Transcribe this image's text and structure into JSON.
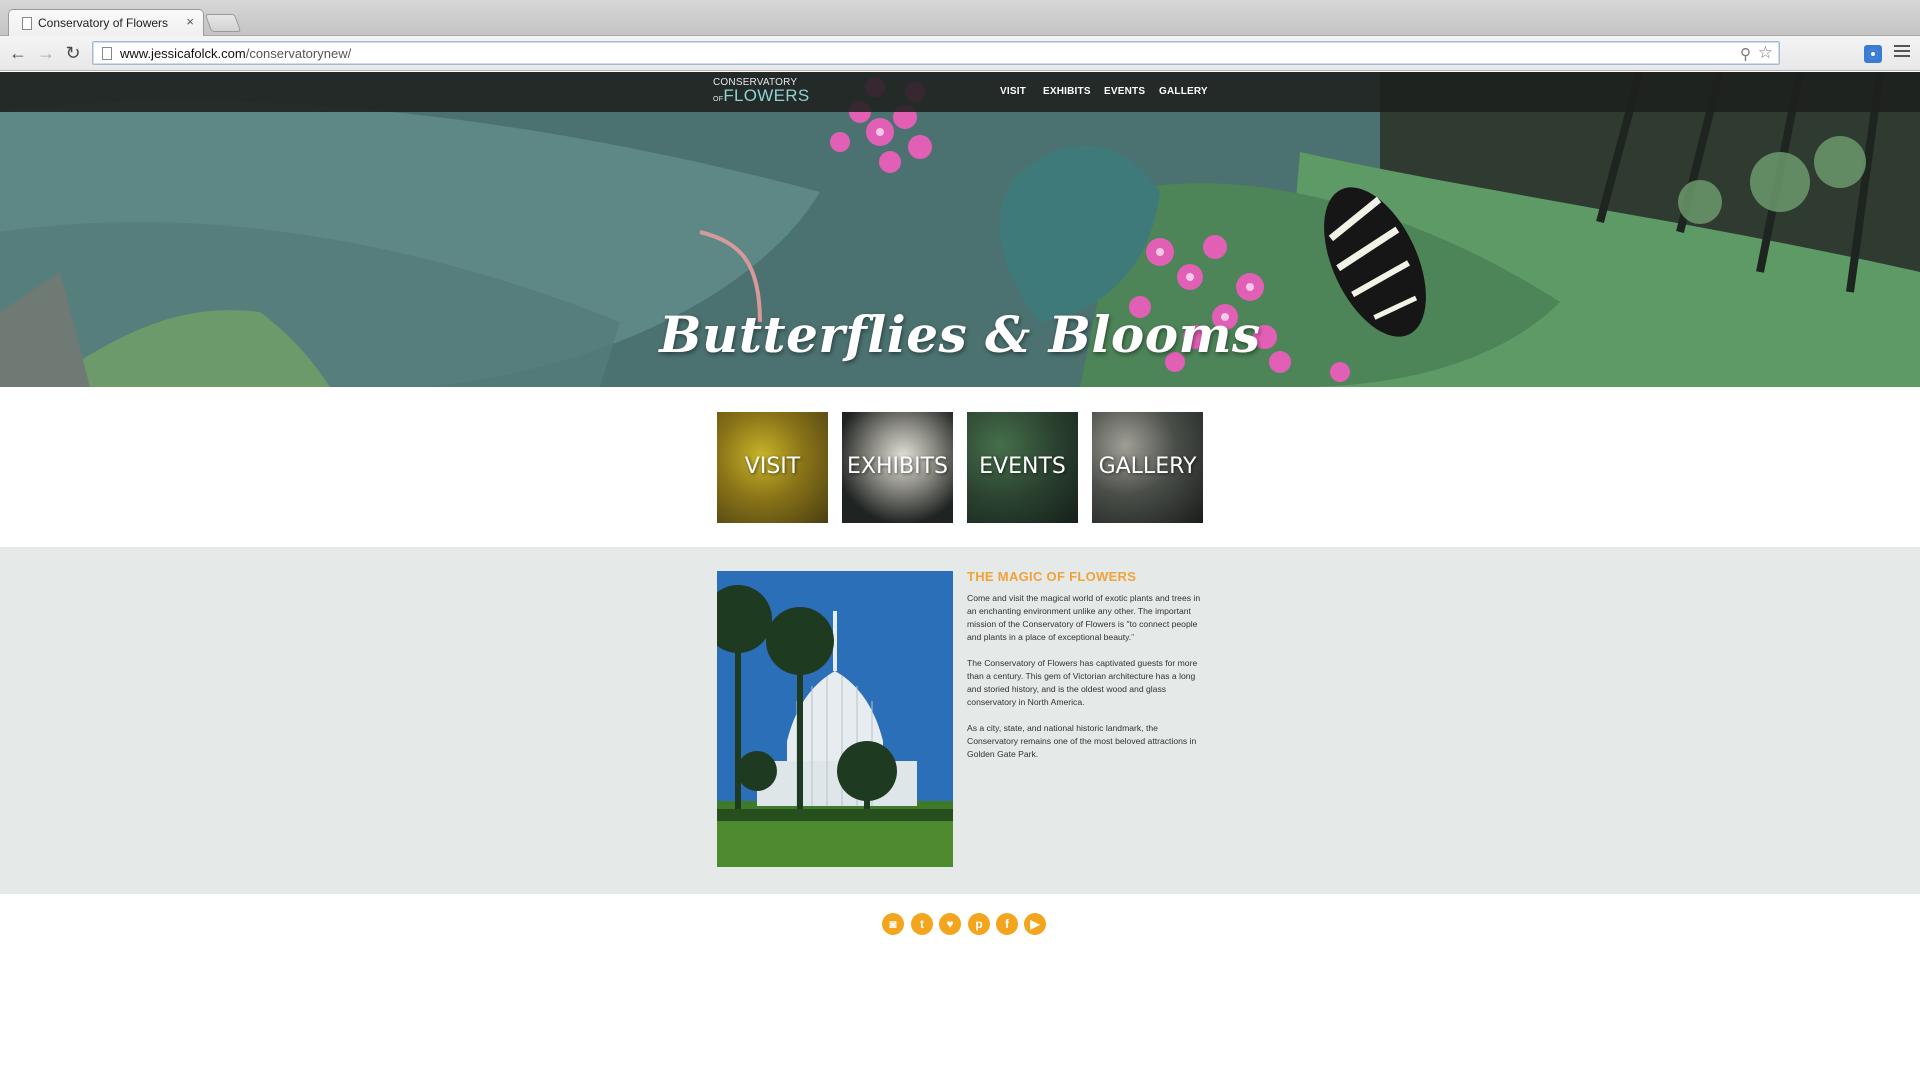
{
  "browser": {
    "tab_title": "Conservatory of Flowers",
    "tab_close": "×",
    "url_domain": "www.jessicafolck.com",
    "url_path": "/conservatorynew/"
  },
  "site": {
    "logo_line1": "CONSERVATORY",
    "logo_of": "OF",
    "logo_line2": "FLOWERS",
    "nav": [
      "VISIT",
      "EXHIBITS",
      "EVENTS",
      "GALLERY"
    ],
    "hero_title": "Butterflies & Blooms",
    "tiles": [
      "VISIT",
      "EXHIBITS",
      "EVENTS",
      "GALLERY"
    ],
    "about": {
      "heading": "THE MAGIC OF FLOWERS",
      "p1_a": "Come and visit the magical world of exotic plants and trees in an enchanting environment unlike any other. The important mission of the Conservatory of Flowers is \"to connect people and plants in a place of exceptional beauty.",
      "p1_quote": "\"",
      "p2": "The Conservatory of Flowers has captivated guests for more than a century. This gem of Victorian architecture has a long and storied history, and is the oldest wood and glass conservatory in North America.",
      "p3": "As a city, state, and national historic landmark, the Conservatory remains one of the most beloved attractions in Golden Gate Park."
    },
    "social": [
      {
        "icon": "instagram-icon",
        "glyph": "◙"
      },
      {
        "icon": "tumblr-icon",
        "glyph": "t"
      },
      {
        "icon": "twitter-icon",
        "glyph": "♥"
      },
      {
        "icon": "pinterest-icon",
        "glyph": "p"
      },
      {
        "icon": "facebook-icon",
        "glyph": "f"
      },
      {
        "icon": "youtube-icon",
        "glyph": "▶"
      }
    ],
    "colors": {
      "accent": "#f2a51d",
      "heading": "#f2a23a",
      "logo_flowers": "#8fd3d3",
      "about_bg": "#e5e9e8"
    }
  }
}
